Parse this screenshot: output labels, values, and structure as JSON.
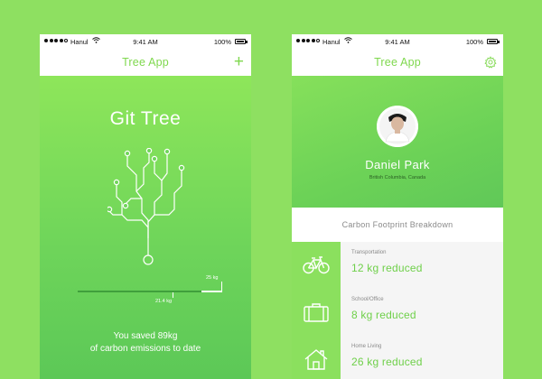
{
  "status_bar": {
    "carrier": "Hanul",
    "time": "9:41 AM",
    "battery": "100%"
  },
  "colors": {
    "background": "#8ee061",
    "accent": "#7fd84e",
    "gradient_light": "#8ee65a",
    "gradient_dark": "#5cc857"
  },
  "left_screen": {
    "nav_title": "Tree App",
    "nav_action_icon": "plus-icon",
    "hero_title": "Git Tree",
    "progress": {
      "goal_label": "25 kg",
      "current_label": "21.4 kg",
      "fraction": 0.856
    },
    "saved_line1": "You saved 89kg",
    "saved_line2": "of carbon emissions to date"
  },
  "right_screen": {
    "nav_title": "Tree App",
    "nav_action_icon": "gear-icon",
    "profile": {
      "name": "Daniel Park",
      "location": "British Columbia, Canada"
    },
    "section_title": "Carbon Footprint Breakdown",
    "items": [
      {
        "icon": "bicycle-icon",
        "label": "Transportation",
        "value": "12 kg reduced"
      },
      {
        "icon": "briefcase-icon",
        "label": "School/Office",
        "value": "8 kg reduced"
      },
      {
        "icon": "house-icon",
        "label": "Home Living",
        "value": "26 kg reduced"
      }
    ]
  }
}
